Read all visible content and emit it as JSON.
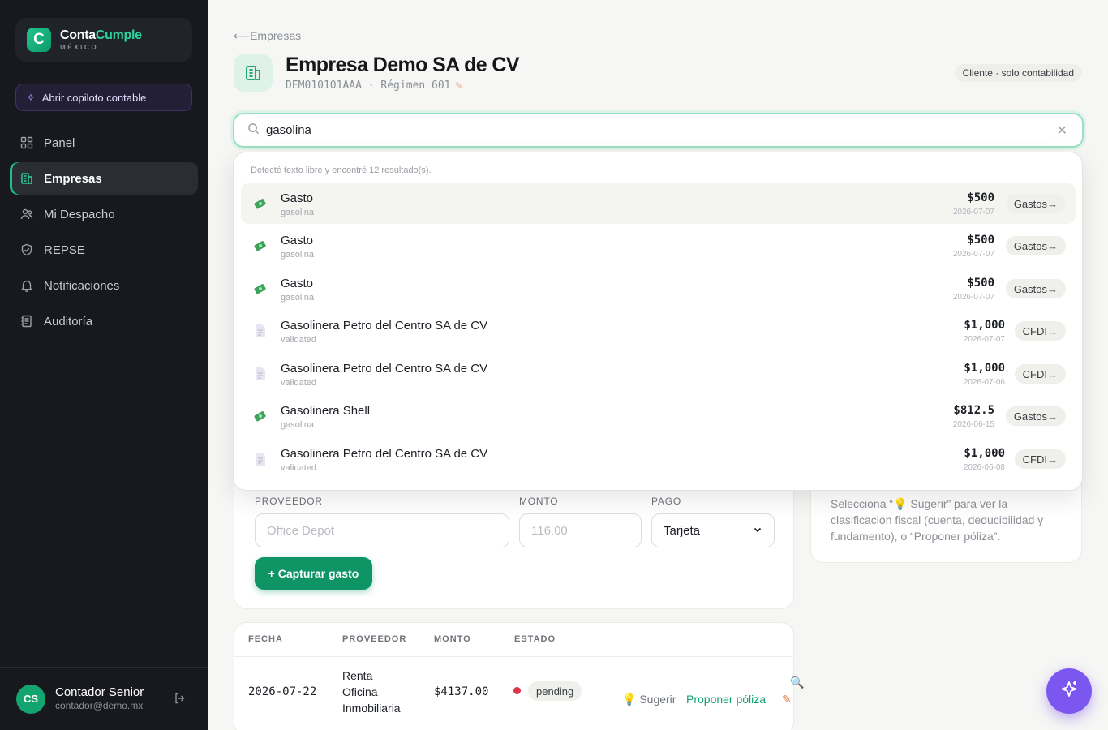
{
  "brand": {
    "name_part1": "Conta",
    "name_part2": "Cumple",
    "subtitle": "MÉXICO",
    "logo_letter": "C"
  },
  "copilot": {
    "label": "Abrir copiloto contable",
    "icon": "sparkle-icon"
  },
  "nav": {
    "items": [
      {
        "label": "Panel",
        "icon": "grid-icon",
        "active": false
      },
      {
        "label": "Empresas",
        "icon": "building-icon",
        "active": true
      },
      {
        "label": "Mi Despacho",
        "icon": "users-icon",
        "active": false
      },
      {
        "label": "REPSE",
        "icon": "shield-icon",
        "active": false
      },
      {
        "label": "Notificaciones",
        "icon": "bell-icon",
        "active": false
      },
      {
        "label": "Auditoría",
        "icon": "ledger-icon",
        "active": false
      }
    ]
  },
  "user": {
    "initials": "CS",
    "name": "Contador Senior",
    "email": "contador@demo.mx"
  },
  "header": {
    "back_label": "Empresas",
    "company_name": "Empresa Demo SA de CV",
    "company_sub": "DEM010101AAA · Régimen 601",
    "role_badge": "Cliente · solo contabilidad"
  },
  "search": {
    "value": "gasolina"
  },
  "dropdown": {
    "hint": "Detecté texto libre y encontré 12 resultado(s).",
    "results": [
      {
        "title": "Gasto",
        "sub": "gasolina",
        "amount": "$500",
        "date": "2026-07-07",
        "chip": "Gastos",
        "kind": "expense"
      },
      {
        "title": "Gasto",
        "sub": "gasolina",
        "amount": "$500",
        "date": "2026-07-07",
        "chip": "Gastos",
        "kind": "expense"
      },
      {
        "title": "Gasto",
        "sub": "gasolina",
        "amount": "$500",
        "date": "2026-07-07",
        "chip": "Gastos",
        "kind": "expense"
      },
      {
        "title": "Gasolinera Petro del Centro SA de CV",
        "sub": "validated",
        "amount": "$1,000",
        "date": "2026-07-07",
        "chip": "CFDI",
        "kind": "cfdi"
      },
      {
        "title": "Gasolinera Petro del Centro SA de CV",
        "sub": "validated",
        "amount": "$1,000",
        "date": "2026-07-06",
        "chip": "CFDI",
        "kind": "cfdi"
      },
      {
        "title": "Gasolinera Shell",
        "sub": "gasolina",
        "amount": "$812.5",
        "date": "2026-06-15",
        "chip": "Gastos",
        "kind": "expense"
      },
      {
        "title": "Gasolinera Petro del Centro SA de CV",
        "sub": "validated",
        "amount": "$1,000",
        "date": "2026-06-08",
        "chip": "CFDI",
        "kind": "cfdi"
      }
    ]
  },
  "form": {
    "proveedor_label": "PROVEEDOR",
    "proveedor_placeholder": "Office Depot",
    "monto_label": "MONTO",
    "monto_placeholder": "116.00",
    "pago_label": "PAGO",
    "pago_value": "Tarjeta",
    "capture_label": "+ Capturar gasto"
  },
  "hint_card": {
    "text": "Selecciona “💡 Sugerir” para ver la clasificación fiscal (cuenta, deducibilidad y fundamento), o “Proponer póliza”."
  },
  "table": {
    "headers": [
      "FECHA",
      "PROVEEDOR",
      "MONTO",
      "ESTADO"
    ],
    "rows": [
      {
        "fecha": "2026-07-22",
        "proveedor_l1": "Renta",
        "proveedor_l2": "Oficina",
        "proveedor_l3": "Inmobiliaria",
        "monto": "$4137.00",
        "estado": "pending",
        "sugerir": "💡 Sugerir",
        "proponer": "Proponer póliza"
      }
    ]
  },
  "colors": {
    "accent": "#1fbf85",
    "brand_green": "#0f9466",
    "fab": "#7b57f0",
    "sidebar": "#17191e",
    "status_pending": "#e0334c"
  }
}
